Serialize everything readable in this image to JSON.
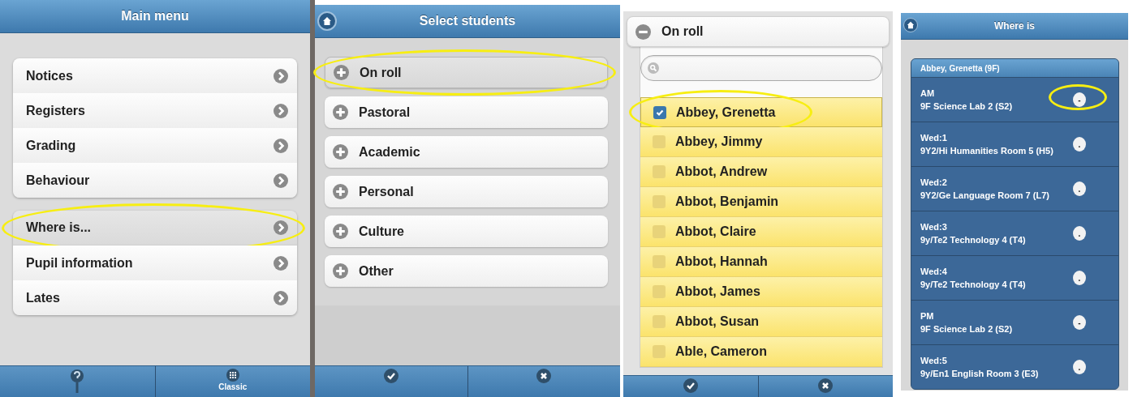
{
  "main_menu": {
    "title": "Main menu",
    "groups": [
      [
        {
          "label": "Notices",
          "highlighted": false
        },
        {
          "label": "Registers",
          "highlighted": false
        },
        {
          "label": "Grading",
          "highlighted": false
        },
        {
          "label": "Behaviour",
          "highlighted": false
        }
      ],
      [
        {
          "label": "Where is...",
          "highlighted": true
        },
        {
          "label": "Pupil information",
          "highlighted": false
        },
        {
          "label": "Lates",
          "highlighted": false
        }
      ]
    ],
    "footer": [
      {
        "kind": "help"
      },
      {
        "kind": "classic",
        "label": "Classic"
      }
    ]
  },
  "select_students": {
    "title": "Select students",
    "categories": [
      {
        "label": "On roll",
        "highlighted": true
      },
      {
        "label": "Pastoral",
        "highlighted": false
      },
      {
        "label": "Academic",
        "highlighted": false
      },
      {
        "label": "Personal",
        "highlighted": false
      },
      {
        "label": "Culture",
        "highlighted": false
      },
      {
        "label": "Other",
        "highlighted": false
      }
    ],
    "footer": [
      {
        "kind": "confirm"
      },
      {
        "kind": "cancel"
      }
    ]
  },
  "on_roll": {
    "label": "On roll",
    "expanded": true,
    "students": [
      {
        "name": "Abbey, Grenetta",
        "checked": true,
        "highlighted": true
      },
      {
        "name": "Abbey, Jimmy",
        "checked": false,
        "highlighted": false
      },
      {
        "name": "Abbot, Andrew",
        "checked": false,
        "highlighted": false
      },
      {
        "name": "Abbot, Benjamin",
        "checked": false,
        "highlighted": false
      },
      {
        "name": "Abbot, Claire",
        "checked": false,
        "highlighted": false
      },
      {
        "name": "Abbot, Hannah",
        "checked": false,
        "highlighted": false
      },
      {
        "name": "Abbot, James",
        "checked": false,
        "highlighted": false
      },
      {
        "name": "Abbot, Susan",
        "checked": false,
        "highlighted": false
      },
      {
        "name": "Able, Cameron",
        "checked": false,
        "highlighted": false
      }
    ],
    "footer": [
      {
        "kind": "confirm"
      },
      {
        "kind": "cancel"
      }
    ]
  },
  "where_is": {
    "title": "Where is",
    "student": "Abbey, Grenetta (9F)",
    "periods": [
      {
        "period": "AM",
        "location": "9F Science Lab 2 (S2)",
        "mark": "-",
        "highlighted": true
      },
      {
        "period": "Wed:1",
        "location": "9Y2/Hi Humanities Room 5 (H5)",
        "mark": ".",
        "highlighted": false
      },
      {
        "period": "Wed:2",
        "location": "9Y2/Ge Language Room 7 (L7)",
        "mark": ".",
        "highlighted": false
      },
      {
        "period": "Wed:3",
        "location": "9y/Te2 Technology 4 (T4)",
        "mark": ".",
        "highlighted": false
      },
      {
        "period": "Wed:4",
        "location": "9y/Te2 Technology 4 (T4)",
        "mark": ".",
        "highlighted": false
      },
      {
        "period": "PM",
        "location": "9F Science Lab 2 (S2)",
        "mark": "-",
        "highlighted": false
      },
      {
        "period": "Wed:5",
        "location": "9y/En1 English Room 3 (E3)",
        "mark": ".",
        "highlighted": false
      }
    ]
  }
}
